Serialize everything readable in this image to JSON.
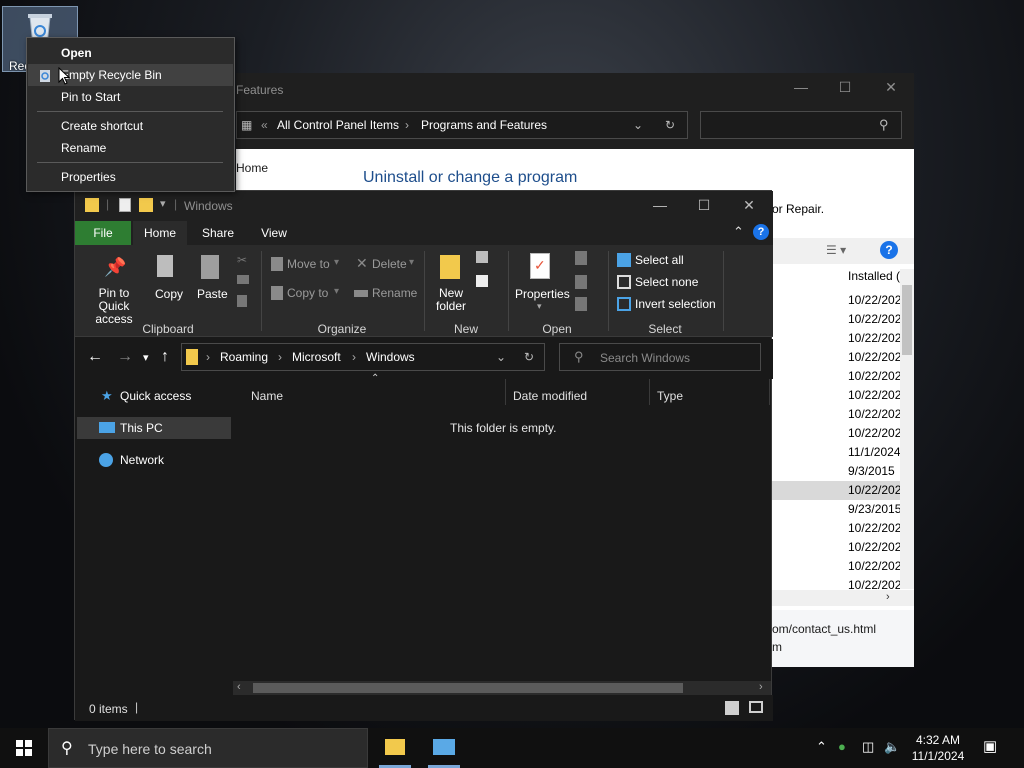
{
  "desktop": {
    "recycle_bin_label": "Rec"
  },
  "context_menu": {
    "items": [
      "Open",
      "Empty Recycle Bin",
      "Pin to Start",
      "Create shortcut",
      "Rename",
      "Properties"
    ]
  },
  "control_panel": {
    "title_suffix": "Features",
    "breadcrumb": [
      "All Control Panel Items",
      "Programs and Features"
    ],
    "home_link": "Home",
    "heading": "Uninstall or change a program",
    "repair_text": "or Repair.",
    "column_header": "Installed (",
    "dates": [
      "10/22/202",
      "10/22/202",
      "10/22/202",
      "10/22/202",
      "10/22/202",
      "10/22/202",
      "10/22/202",
      "10/22/202",
      "11/1/2024",
      "9/3/2015",
      "10/22/202",
      "9/23/2015",
      "10/22/202",
      "10/22/202",
      "10/22/202",
      "10/22/202"
    ],
    "footer_line1": "om/contact_us.html",
    "footer_line2": "m"
  },
  "explorer": {
    "title": "Windows",
    "tabs": [
      "File",
      "Home",
      "Share",
      "View"
    ],
    "ribbon": {
      "pin_quick_access": "Pin to Quick access",
      "copy": "Copy",
      "paste": "Paste",
      "clipboard": "Clipboard",
      "move_to": "Move to",
      "copy_to": "Copy to",
      "delete": "Delete",
      "rename": "Rename",
      "organize": "Organize",
      "new_folder": "New folder",
      "new": "New",
      "properties": "Properties",
      "open": "Open",
      "select_all": "Select all",
      "select_none": "Select none",
      "invert_selection": "Invert selection",
      "select": "Select"
    },
    "address": [
      "Roaming",
      "Microsoft",
      "Windows"
    ],
    "search_placeholder": "Search Windows",
    "sidebar": [
      "Quick access",
      "This PC",
      "Network"
    ],
    "columns": [
      "Name",
      "Date modified",
      "Type"
    ],
    "empty_message": "This folder is empty.",
    "status": "0 items"
  },
  "taskbar": {
    "search_placeholder": "Type here to search",
    "time": "4:32 AM",
    "date": "11/1/2024"
  },
  "colors": {
    "accent_file_tab": "#2e7d32",
    "cp_heading": "#1e4e8c",
    "help_blue": "#1a73e8"
  }
}
